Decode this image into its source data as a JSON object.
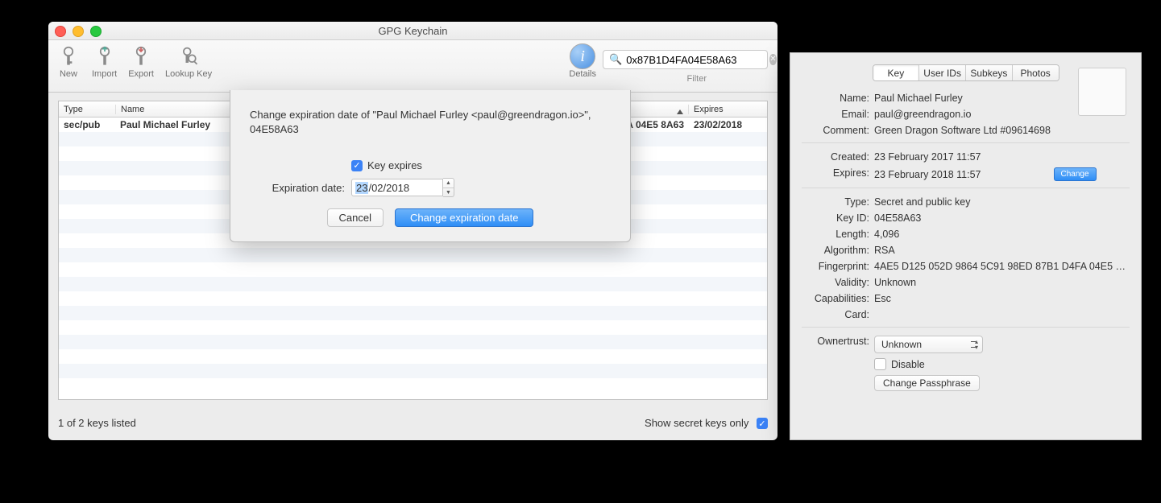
{
  "window": {
    "title": "GPG Keychain"
  },
  "toolbar": {
    "new": "New",
    "import": "Import",
    "export": "Export",
    "lookup": "Lookup Key",
    "details": "Details",
    "filter": "Filter",
    "search_value": "0x87B1D4FA04E58A63"
  },
  "table": {
    "headers": {
      "type": "Type",
      "name": "Name",
      "expires": "Expires"
    },
    "row": {
      "type": "sec/pub",
      "name": "Paul Michael Furley",
      "fingerprint_tail": "A 04E5 8A63",
      "expires": "23/02/2018"
    }
  },
  "status": {
    "left": "1 of 2 keys listed",
    "right": "Show secret keys only"
  },
  "sheet": {
    "title": "Change expiration date of \"Paul Michael Furley <paul@greendragon.io>\", 04E58A63",
    "key_expires_label": "Key expires",
    "expiration_label": "Expiration date:",
    "date_day": "23",
    "date_rest": "/02/2018",
    "cancel": "Cancel",
    "confirm": "Change expiration date"
  },
  "inspector": {
    "tabs": {
      "key": "Key",
      "userids": "User IDs",
      "subkeys": "Subkeys",
      "photos": "Photos"
    },
    "name_label": "Name:",
    "name": "Paul Michael Furley",
    "email_label": "Email:",
    "email": "paul@greendragon.io",
    "comment_label": "Comment:",
    "comment": "Green Dragon Software Ltd #09614698",
    "created_label": "Created:",
    "created": "23 February 2017 11:57",
    "expires_label": "Expires:",
    "expires": "23 February 2018 11:57",
    "change": "Change",
    "type_label": "Type:",
    "type": "Secret and public key",
    "keyid_label": "Key ID:",
    "keyid": "04E58A63",
    "length_label": "Length:",
    "length": "4,096",
    "algorithm_label": "Algorithm:",
    "algorithm": "RSA",
    "fingerprint_label": "Fingerprint:",
    "fingerprint": "4AE5 D125 052D 9864 5C91  98ED 87B1 D4FA 04E5 8A…",
    "validity_label": "Validity:",
    "validity": "Unknown",
    "capabilities_label": "Capabilities:",
    "capabilities": "Esc",
    "card_label": "Card:",
    "card": "",
    "ownertrust_label": "Ownertrust:",
    "ownertrust": "Unknown",
    "disable": "Disable",
    "change_passphrase": "Change Passphrase"
  }
}
